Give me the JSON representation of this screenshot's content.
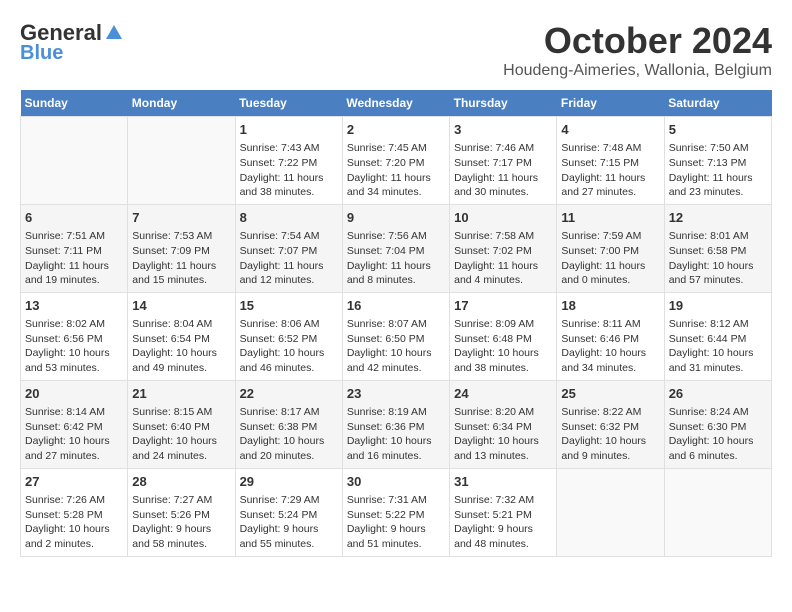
{
  "header": {
    "logo_general": "General",
    "logo_blue": "Blue",
    "month_title": "October 2024",
    "location": "Houdeng-Aimeries, Wallonia, Belgium"
  },
  "weekdays": [
    "Sunday",
    "Monday",
    "Tuesday",
    "Wednesday",
    "Thursday",
    "Friday",
    "Saturday"
  ],
  "weeks": [
    [
      {
        "day": "",
        "info": ""
      },
      {
        "day": "",
        "info": ""
      },
      {
        "day": "1",
        "info": "Sunrise: 7:43 AM\nSunset: 7:22 PM\nDaylight: 11 hours\nand 38 minutes."
      },
      {
        "day": "2",
        "info": "Sunrise: 7:45 AM\nSunset: 7:20 PM\nDaylight: 11 hours\nand 34 minutes."
      },
      {
        "day": "3",
        "info": "Sunrise: 7:46 AM\nSunset: 7:17 PM\nDaylight: 11 hours\nand 30 minutes."
      },
      {
        "day": "4",
        "info": "Sunrise: 7:48 AM\nSunset: 7:15 PM\nDaylight: 11 hours\nand 27 minutes."
      },
      {
        "day": "5",
        "info": "Sunrise: 7:50 AM\nSunset: 7:13 PM\nDaylight: 11 hours\nand 23 minutes."
      }
    ],
    [
      {
        "day": "6",
        "info": "Sunrise: 7:51 AM\nSunset: 7:11 PM\nDaylight: 11 hours\nand 19 minutes."
      },
      {
        "day": "7",
        "info": "Sunrise: 7:53 AM\nSunset: 7:09 PM\nDaylight: 11 hours\nand 15 minutes."
      },
      {
        "day": "8",
        "info": "Sunrise: 7:54 AM\nSunset: 7:07 PM\nDaylight: 11 hours\nand 12 minutes."
      },
      {
        "day": "9",
        "info": "Sunrise: 7:56 AM\nSunset: 7:04 PM\nDaylight: 11 hours\nand 8 minutes."
      },
      {
        "day": "10",
        "info": "Sunrise: 7:58 AM\nSunset: 7:02 PM\nDaylight: 11 hours\nand 4 minutes."
      },
      {
        "day": "11",
        "info": "Sunrise: 7:59 AM\nSunset: 7:00 PM\nDaylight: 11 hours\nand 0 minutes."
      },
      {
        "day": "12",
        "info": "Sunrise: 8:01 AM\nSunset: 6:58 PM\nDaylight: 10 hours\nand 57 minutes."
      }
    ],
    [
      {
        "day": "13",
        "info": "Sunrise: 8:02 AM\nSunset: 6:56 PM\nDaylight: 10 hours\nand 53 minutes."
      },
      {
        "day": "14",
        "info": "Sunrise: 8:04 AM\nSunset: 6:54 PM\nDaylight: 10 hours\nand 49 minutes."
      },
      {
        "day": "15",
        "info": "Sunrise: 8:06 AM\nSunset: 6:52 PM\nDaylight: 10 hours\nand 46 minutes."
      },
      {
        "day": "16",
        "info": "Sunrise: 8:07 AM\nSunset: 6:50 PM\nDaylight: 10 hours\nand 42 minutes."
      },
      {
        "day": "17",
        "info": "Sunrise: 8:09 AM\nSunset: 6:48 PM\nDaylight: 10 hours\nand 38 minutes."
      },
      {
        "day": "18",
        "info": "Sunrise: 8:11 AM\nSunset: 6:46 PM\nDaylight: 10 hours\nand 34 minutes."
      },
      {
        "day": "19",
        "info": "Sunrise: 8:12 AM\nSunset: 6:44 PM\nDaylight: 10 hours\nand 31 minutes."
      }
    ],
    [
      {
        "day": "20",
        "info": "Sunrise: 8:14 AM\nSunset: 6:42 PM\nDaylight: 10 hours\nand 27 minutes."
      },
      {
        "day": "21",
        "info": "Sunrise: 8:15 AM\nSunset: 6:40 PM\nDaylight: 10 hours\nand 24 minutes."
      },
      {
        "day": "22",
        "info": "Sunrise: 8:17 AM\nSunset: 6:38 PM\nDaylight: 10 hours\nand 20 minutes."
      },
      {
        "day": "23",
        "info": "Sunrise: 8:19 AM\nSunset: 6:36 PM\nDaylight: 10 hours\nand 16 minutes."
      },
      {
        "day": "24",
        "info": "Sunrise: 8:20 AM\nSunset: 6:34 PM\nDaylight: 10 hours\nand 13 minutes."
      },
      {
        "day": "25",
        "info": "Sunrise: 8:22 AM\nSunset: 6:32 PM\nDaylight: 10 hours\nand 9 minutes."
      },
      {
        "day": "26",
        "info": "Sunrise: 8:24 AM\nSunset: 6:30 PM\nDaylight: 10 hours\nand 6 minutes."
      }
    ],
    [
      {
        "day": "27",
        "info": "Sunrise: 7:26 AM\nSunset: 5:28 PM\nDaylight: 10 hours\nand 2 minutes."
      },
      {
        "day": "28",
        "info": "Sunrise: 7:27 AM\nSunset: 5:26 PM\nDaylight: 9 hours\nand 58 minutes."
      },
      {
        "day": "29",
        "info": "Sunrise: 7:29 AM\nSunset: 5:24 PM\nDaylight: 9 hours\nand 55 minutes."
      },
      {
        "day": "30",
        "info": "Sunrise: 7:31 AM\nSunset: 5:22 PM\nDaylight: 9 hours\nand 51 minutes."
      },
      {
        "day": "31",
        "info": "Sunrise: 7:32 AM\nSunset: 5:21 PM\nDaylight: 9 hours\nand 48 minutes."
      },
      {
        "day": "",
        "info": ""
      },
      {
        "day": "",
        "info": ""
      }
    ]
  ]
}
